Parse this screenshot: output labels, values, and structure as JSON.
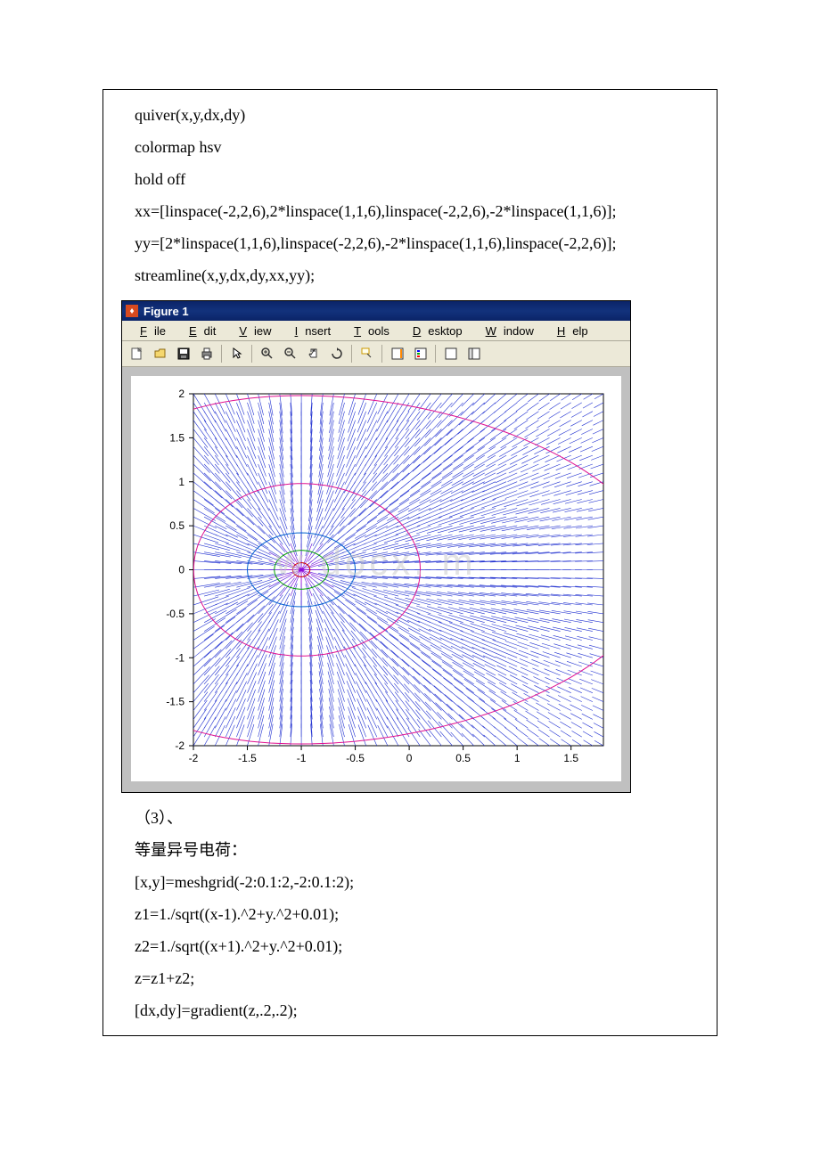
{
  "code": {
    "l1": "quiver(x,y,dx,dy)",
    "l2": "colormap hsv",
    "l3": "hold off",
    "l4": "xx=[linspace(-2,2,6),2*linspace(1,1,6),linspace(-2,2,6),-2*linspace(1,1,6)];",
    "l5": "yy=[2*linspace(1,1,6),linspace(-2,2,6),-2*linspace(1,1,6),linspace(-2,2,6)];",
    "l6": "streamline(x,y,dx,dy,xx,yy);"
  },
  "figure": {
    "title": "Figure 1",
    "menu": {
      "file": "File",
      "edit": "Edit",
      "view": "View",
      "insert": "Insert",
      "tools": "Tools",
      "desktop": "Desktop",
      "window": "Window",
      "help": "Help"
    }
  },
  "chart_data": {
    "type": "plot",
    "xlim": [
      -2,
      1.8
    ],
    "ylim": [
      -2,
      2
    ],
    "xticks": [
      -2,
      -1.5,
      -1,
      -0.5,
      0,
      0.5,
      1,
      1.5
    ],
    "yticks": [
      -2,
      -1.5,
      -1,
      -0.5,
      0,
      0.5,
      1,
      1.5,
      2
    ],
    "quiver_grid": {
      "xmin": -2,
      "xmax": 2,
      "ymin": -2,
      "ymax": 2,
      "step": 0.1
    },
    "streamlines": "closed orbits around (-1,0) from boundary seeds",
    "center": [
      -1,
      0
    ]
  },
  "after": {
    "section": "（3）、",
    "label": "等量异号电荷：",
    "c1": "[x,y]=meshgrid(-2:0.1:2,-2:0.1:2);",
    "c2": "z1=1./sqrt((x-1).^2+y.^2+0.01);",
    "c3": "z2=1./sqrt((x+1).^2+y.^2+0.01);",
    "c4": "z=z1+z2;",
    "c5": "[dx,dy]=gradient(z,.2,.2);"
  },
  "watermark": "w      docx.    m"
}
